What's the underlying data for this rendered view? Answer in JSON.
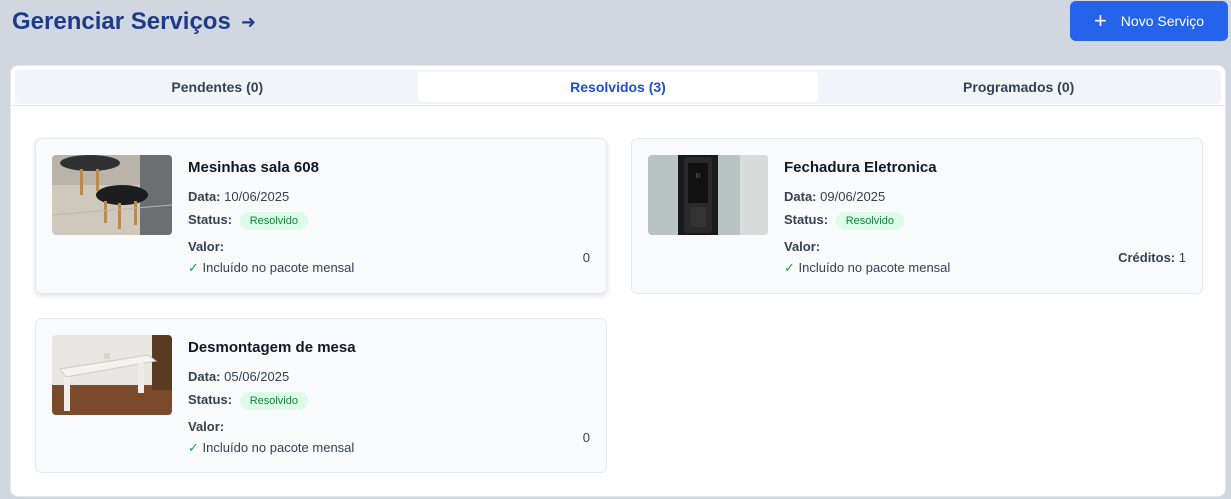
{
  "header": {
    "title": "Gerenciar Serviços",
    "new_service_label": "Novo Serviço"
  },
  "tabs": [
    {
      "label": "Pendentes (0)",
      "active": false
    },
    {
      "label": "Resolvidos (3)",
      "active": true
    },
    {
      "label": "Programados (0)",
      "active": false
    }
  ],
  "services": [
    {
      "title": "Mesinhas sala 608",
      "date_label": "Data:",
      "date": "10/06/2025",
      "status_label": "Status:",
      "status": "Resolvido",
      "value_label": "Valor:",
      "included_text": "Incluído no pacote mensal",
      "right_value": "0"
    },
    {
      "title": "Fechadura Eletronica",
      "date_label": "Data:",
      "date": "09/06/2025",
      "status_label": "Status:",
      "status": "Resolvido",
      "value_label": "Valor:",
      "included_text": "Incluído no pacote mensal",
      "credits_label": "Créditos:",
      "right_value": "1"
    },
    {
      "title": "Desmontagem de mesa",
      "date_label": "Data:",
      "date": "05/06/2025",
      "status_label": "Status:",
      "status": "Resolvido",
      "value_label": "Valor:",
      "included_text": "Incluído no pacote mensal",
      "right_value": "0"
    }
  ],
  "colors": {
    "accent": "#2563eb",
    "title": "#1e3a8a",
    "badge_bg": "#dcfce7",
    "badge_text": "#15803d"
  }
}
